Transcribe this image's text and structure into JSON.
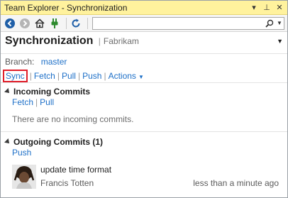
{
  "window": {
    "title": "Team Explorer - Synchronization",
    "controls": {
      "dropdown": "▾",
      "pin": "⊥",
      "close": "✕"
    }
  },
  "toolbar": {
    "icons": [
      "back-icon",
      "forward-icon",
      "home-icon",
      "connect-icon",
      "refresh-icon"
    ],
    "search_value": "",
    "search_icon": "search-icon"
  },
  "header": {
    "title": "Synchronization",
    "subtitle": "Fabrikam"
  },
  "branch": {
    "label": "Branch:",
    "name": "master"
  },
  "actions": {
    "sync": "Sync",
    "fetch": "Fetch",
    "pull": "Pull",
    "push": "Push",
    "actions": "Actions"
  },
  "incoming": {
    "title": "Incoming Commits",
    "fetch": "Fetch",
    "pull": "Pull",
    "empty_text": "There are no incoming commits."
  },
  "outgoing": {
    "title": "Outgoing Commits (1)",
    "push": "Push",
    "commits": [
      {
        "message": "update time format",
        "author": "Francis Totten",
        "time": "less than a minute ago"
      }
    ]
  },
  "colors": {
    "titlebar": "#fff29d",
    "link": "#1e70c8",
    "highlight": "#e01e2a"
  }
}
